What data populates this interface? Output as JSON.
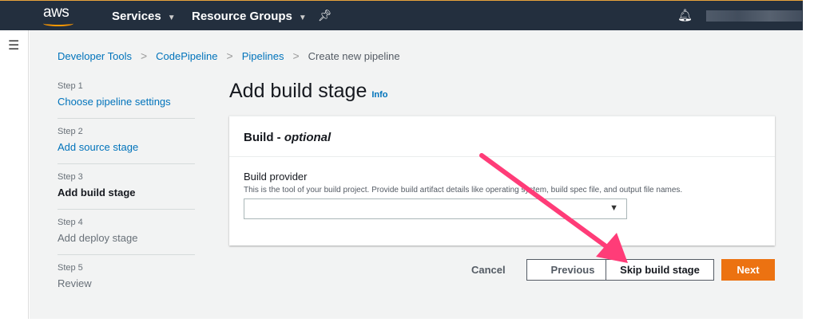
{
  "nav": {
    "logo": "aws",
    "services": "Services",
    "resource_groups": "Resource Groups"
  },
  "breadcrumb": [
    "Developer Tools",
    "CodePipeline",
    "Pipelines",
    "Create new pipeline"
  ],
  "steps": [
    {
      "num": "Step 1",
      "label": "Choose pipeline settings"
    },
    {
      "num": "Step 2",
      "label": "Add source stage"
    },
    {
      "num": "Step 3",
      "label": "Add build stage"
    },
    {
      "num": "Step 4",
      "label": "Add deploy stage"
    },
    {
      "num": "Step 5",
      "label": "Review"
    }
  ],
  "page": {
    "title": "Add build stage",
    "info": "Info"
  },
  "panel": {
    "title": "Build - ",
    "title_italic": "optional",
    "field_label": "Build provider",
    "field_desc": "This is the tool of your build project. Provide build artifact details like operating system, build spec file, and output file names.",
    "value": ""
  },
  "buttons": {
    "cancel": "Cancel",
    "previous": "Previous",
    "skip": "Skip build stage",
    "next": "Next"
  },
  "colors": {
    "arrow": "#ff3c78",
    "primary": "#ec7211",
    "nav": "#232f3e"
  }
}
